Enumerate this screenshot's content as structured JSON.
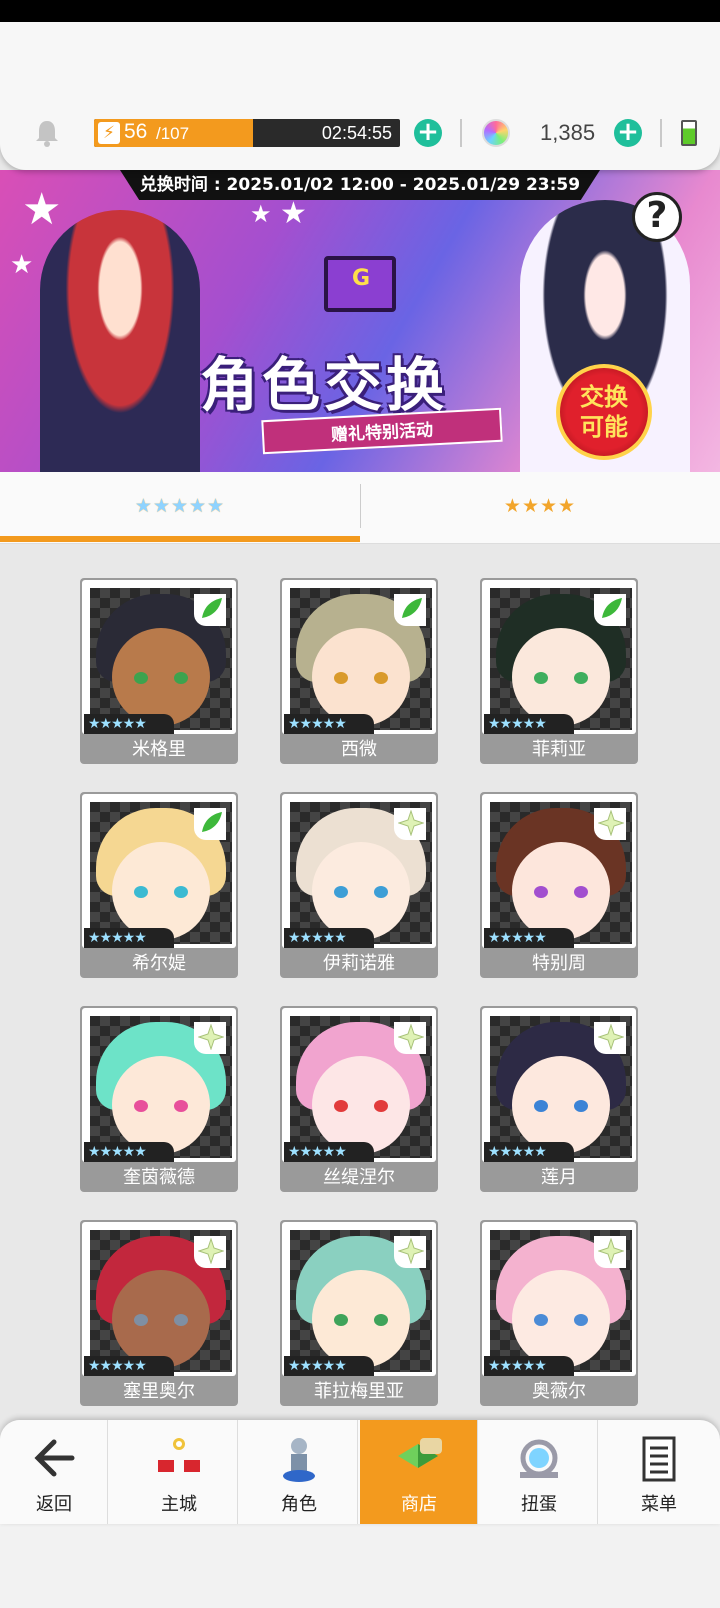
{
  "header": {
    "stamina_current": "56",
    "stamina_max": "/107",
    "stamina_fraction": 0.52,
    "stamina_timer": "02:54:55",
    "gem_count": "1,385",
    "plus_label": "+"
  },
  "banner": {
    "date_range": "兑换时间 : 2025.01/02 12:00 - 2025.01/29 23:59",
    "title": "角色交换",
    "subtitle": "赠礼特别活动",
    "seal_line1": "交换",
    "seal_line2": "可能",
    "help": "?"
  },
  "tabs": [
    {
      "label": "★★★★★",
      "active": true
    },
    {
      "label": "★★★★",
      "active": false
    }
  ],
  "characters": [
    {
      "name": "米格里",
      "stars": "★★★★★",
      "tag": "leaf",
      "hair": "#2a2a36",
      "skin": "#b87a4b",
      "eye": "#3da34e"
    },
    {
      "name": "西微",
      "stars": "★★★★★",
      "tag": "leaf",
      "hair": "#b7b18f",
      "skin": "#fbe2cf",
      "eye": "#d99a2b"
    },
    {
      "name": "菲莉亚",
      "stars": "★★★★★",
      "tag": "leaf",
      "hair": "#1f2e25",
      "skin": "#fbe8dc",
      "eye": "#3fae5e"
    },
    {
      "name": "希尔媞",
      "stars": "★★★★★",
      "tag": "leaf",
      "hair": "#f5d792",
      "skin": "#fde9d6",
      "eye": "#3bbad2"
    },
    {
      "name": "伊莉诺雅",
      "stars": "★★★★★",
      "tag": "star",
      "hair": "#ece0d2",
      "skin": "#fcebdf",
      "eye": "#3d9ed6"
    },
    {
      "name": "特别周",
      "stars": "★★★★★",
      "tag": "star",
      "hair": "#6a3424",
      "skin": "#fde6dc",
      "eye": "#a24fcf"
    },
    {
      "name": "奎茵薇德",
      "stars": "★★★★★",
      "tag": "star",
      "hair": "#6de3c8",
      "skin": "#fde8d8",
      "eye": "#e84f9b"
    },
    {
      "name": "丝缇涅尔",
      "stars": "★★★★★",
      "tag": "star",
      "hair": "#f1a4cf",
      "skin": "#fde6e6",
      "eye": "#e23b3b"
    },
    {
      "name": "莲月",
      "stars": "★★★★★",
      "tag": "star",
      "hair": "#2d2a45",
      "skin": "#fde8de",
      "eye": "#3b83d6"
    },
    {
      "name": "塞里奥尔",
      "stars": "★★★★★",
      "tag": "star",
      "hair": "#c2273d",
      "skin": "#a86a4c",
      "eye": "#7f8fa3"
    },
    {
      "name": "菲拉梅里亚",
      "stars": "★★★★★",
      "tag": "star",
      "hair": "#8ad0c0",
      "skin": "#fde9d6",
      "eye": "#3fa35a"
    },
    {
      "name": "奥薇尔",
      "stars": "★★★★★",
      "tag": "star",
      "hair": "#f4b2cf",
      "skin": "#fdeae2",
      "eye": "#4b8bd6"
    }
  ],
  "nav": {
    "back": "返回",
    "items": [
      {
        "label": "主城",
        "icon": "castle-icon",
        "active": false
      },
      {
        "label": "角色",
        "icon": "character-icon",
        "active": false
      },
      {
        "label": "商店",
        "icon": "shop-icon",
        "active": true
      },
      {
        "label": "扭蛋",
        "icon": "gacha-icon",
        "active": false
      },
      {
        "label": "菜单",
        "icon": "menu-icon",
        "active": false
      }
    ]
  },
  "colors": {
    "accent": "#f39a1e",
    "plus": "#1fbf9b",
    "card_bg": "#9a9a9a"
  }
}
